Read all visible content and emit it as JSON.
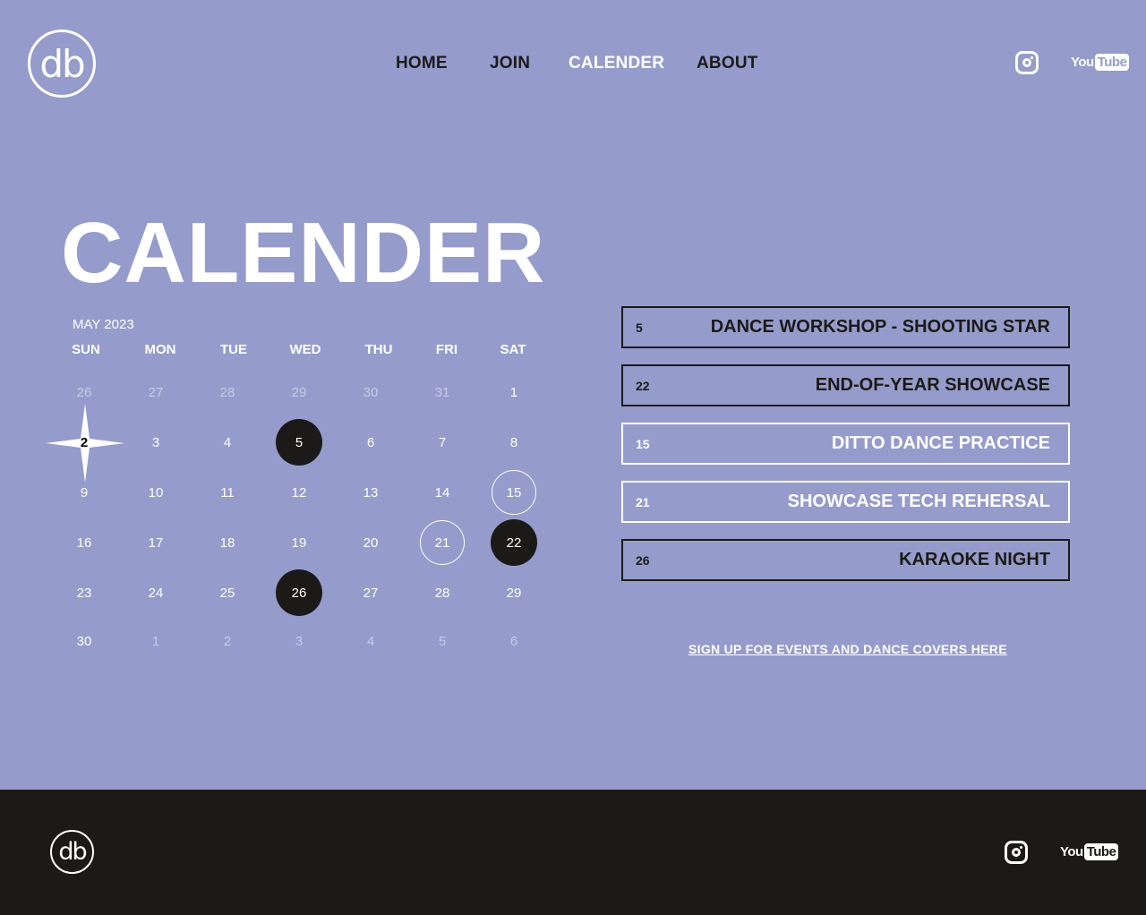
{
  "brand": {
    "logo_text": "db"
  },
  "nav": [
    {
      "label": "HOME",
      "active": false
    },
    {
      "label": "JOIN",
      "active": false
    },
    {
      "label": "CALENDER",
      "active": true
    },
    {
      "label": "ABOUT",
      "active": false
    }
  ],
  "social": {
    "instagram_icon": "instagram-icon",
    "youtube_you": "You",
    "youtube_tube": "Tube"
  },
  "page_title": "CALENDER",
  "calendar": {
    "month_label": "MAY 2023",
    "weekdays": [
      "SUN",
      "MON",
      "TUE",
      "WED",
      "THU",
      "FRI",
      "SAT"
    ],
    "weeks": [
      [
        {
          "d": "26",
          "muted": true
        },
        {
          "d": "27",
          "muted": true
        },
        {
          "d": "28",
          "muted": true
        },
        {
          "d": "29",
          "muted": true
        },
        {
          "d": "30",
          "muted": true
        },
        {
          "d": "31",
          "muted": true
        },
        {
          "d": "1"
        }
      ],
      [
        {
          "d": "2",
          "today": true
        },
        {
          "d": "3"
        },
        {
          "d": "4"
        },
        {
          "d": "5",
          "style": "filled"
        },
        {
          "d": "6"
        },
        {
          "d": "7"
        },
        {
          "d": "8"
        }
      ],
      [
        {
          "d": "9"
        },
        {
          "d": "10"
        },
        {
          "d": "11"
        },
        {
          "d": "12"
        },
        {
          "d": "13"
        },
        {
          "d": "14"
        },
        {
          "d": "15",
          "style": "ring"
        }
      ],
      [
        {
          "d": "16"
        },
        {
          "d": "17"
        },
        {
          "d": "18"
        },
        {
          "d": "19"
        },
        {
          "d": "20"
        },
        {
          "d": "21",
          "style": "ring"
        },
        {
          "d": "22",
          "style": "filled"
        }
      ],
      [
        {
          "d": "23"
        },
        {
          "d": "24"
        },
        {
          "d": "25"
        },
        {
          "d": "26",
          "style": "filled"
        },
        {
          "d": "27"
        },
        {
          "d": "28"
        },
        {
          "d": "29"
        }
      ],
      [
        {
          "d": "30"
        },
        {
          "d": "1",
          "muted": true
        },
        {
          "d": "2",
          "muted": true
        },
        {
          "d": "3",
          "muted": true
        },
        {
          "d": "4",
          "muted": true
        },
        {
          "d": "5",
          "muted": true
        },
        {
          "d": "6",
          "muted": true
        }
      ]
    ]
  },
  "events": [
    {
      "date": "5",
      "title": "DANCE WORKSHOP - SHOOTING STAR",
      "style": "dark"
    },
    {
      "date": "22",
      "title": "END-OF-YEAR SHOWCASE",
      "style": "dark"
    },
    {
      "date": "15",
      "title": "DITTO DANCE PRACTICE",
      "style": "light"
    },
    {
      "date": "21",
      "title": "SHOWCASE TECH REHERSAL",
      "style": "light"
    },
    {
      "date": "26",
      "title": "KARAOKE NIGHT",
      "style": "dark"
    }
  ],
  "signup_link": "SIGN UP FOR EVENTS AND DANCE COVERS HERE",
  "colors": {
    "background": "#959ccb",
    "dark": "#1b1a18",
    "text": "#ffffff"
  }
}
